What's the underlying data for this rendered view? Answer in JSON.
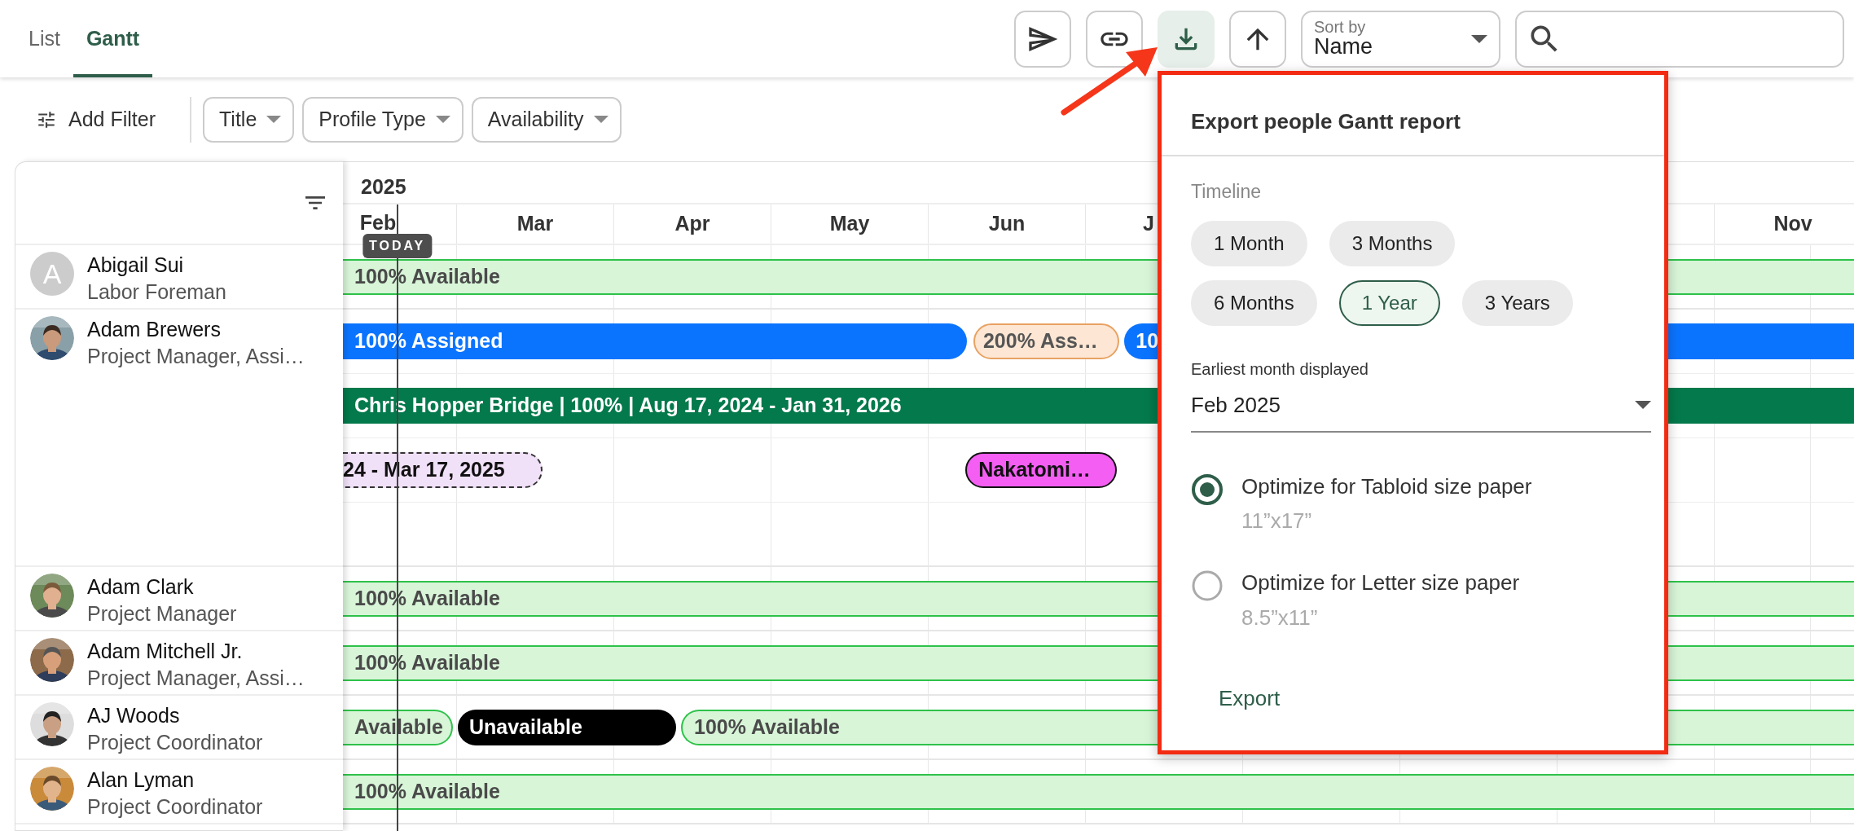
{
  "tabs": [
    {
      "label": "List",
      "selected": false
    },
    {
      "label": "Gantt",
      "selected": true
    }
  ],
  "toolbar": {
    "buttons": [
      {
        "kind": "send",
        "selected": false
      },
      {
        "kind": "link",
        "selected": false
      },
      {
        "kind": "download",
        "selected": true
      },
      {
        "kind": "sort-direction",
        "selected": false
      }
    ],
    "sort": {
      "label": "Sort by",
      "value": "Name"
    }
  },
  "filters": {
    "add_label": "Add Filter",
    "chips": [
      "Title",
      "Profile Type",
      "Availability"
    ]
  },
  "gantt": {
    "year": "2025",
    "today_label": "TODAY",
    "months": [
      "Feb",
      "Mar",
      "Apr",
      "May",
      "Jun",
      "J",
      "Nov"
    ],
    "people": [
      {
        "name": "Abigail Sui",
        "title": "Labor Foreman",
        "avatar": {
          "kind": "initial",
          "text": "A"
        },
        "lanes": [
          [
            {
              "text": "100% Available",
              "kind": "available"
            }
          ]
        ]
      },
      {
        "name": "Adam Brewers",
        "title": "Project Manager, Assi…",
        "avatar": {
          "kind": "picture"
        },
        "lanes": [
          [
            {
              "text": "100% Assigned",
              "kind": "assigned"
            },
            {
              "text": "200% Ass…",
              "kind": "overallocated"
            },
            {
              "text": "10",
              "kind": "assigned"
            }
          ],
          [
            {
              "text": "Chris Hopper Bridge | 100% | Aug 17, 2024 - Jan 31, 2026",
              "kind": "project"
            }
          ],
          [
            {
              "text": "24 - Mar 17, 2025",
              "kind": "tentative"
            },
            {
              "text": "Nakatomi…",
              "kind": "highlight"
            }
          ]
        ]
      },
      {
        "name": "Adam Clark",
        "title": "Project Manager",
        "avatar": {
          "kind": "picture"
        },
        "lanes": [
          [
            {
              "text": "100% Available",
              "kind": "available"
            }
          ]
        ]
      },
      {
        "name": "Adam Mitchell Jr.",
        "title": "Project Manager, Assi…",
        "avatar": {
          "kind": "picture"
        },
        "lanes": [
          [
            {
              "text": "100% Available",
              "kind": "available"
            }
          ]
        ]
      },
      {
        "name": "AJ Woods",
        "title": "Project Coordinator",
        "avatar": {
          "kind": "picture"
        },
        "lanes": [
          [
            {
              "text": "Available",
              "kind": "available"
            },
            {
              "text": "Unavailable",
              "kind": "unavailable"
            },
            {
              "text": "100% Available",
              "kind": "available"
            }
          ]
        ]
      },
      {
        "name": "Alan Lyman",
        "title": "Project Coordinator",
        "avatar": {
          "kind": "picture"
        },
        "lanes": [
          [
            {
              "text": "100% Available",
              "kind": "available"
            }
          ]
        ]
      }
    ]
  },
  "export_dialog": {
    "title": "Export people Gantt report",
    "timeline_label": "Timeline",
    "timeline_options": [
      {
        "label": "1 Month",
        "selected": false
      },
      {
        "label": "3 Months",
        "selected": false
      },
      {
        "label": "6 Months",
        "selected": false
      },
      {
        "label": "1 Year",
        "selected": true
      },
      {
        "label": "3 Years",
        "selected": false
      }
    ],
    "month_field": {
      "label": "Earliest month displayed",
      "value": "Feb 2025"
    },
    "paper_options": [
      {
        "label": "Optimize for Tabloid size paper",
        "size": "11”x17”",
        "checked": true
      },
      {
        "label": "Optimize for Letter size paper",
        "size": "8.5”x11”",
        "checked": false
      }
    ],
    "export_label": "Export"
  }
}
